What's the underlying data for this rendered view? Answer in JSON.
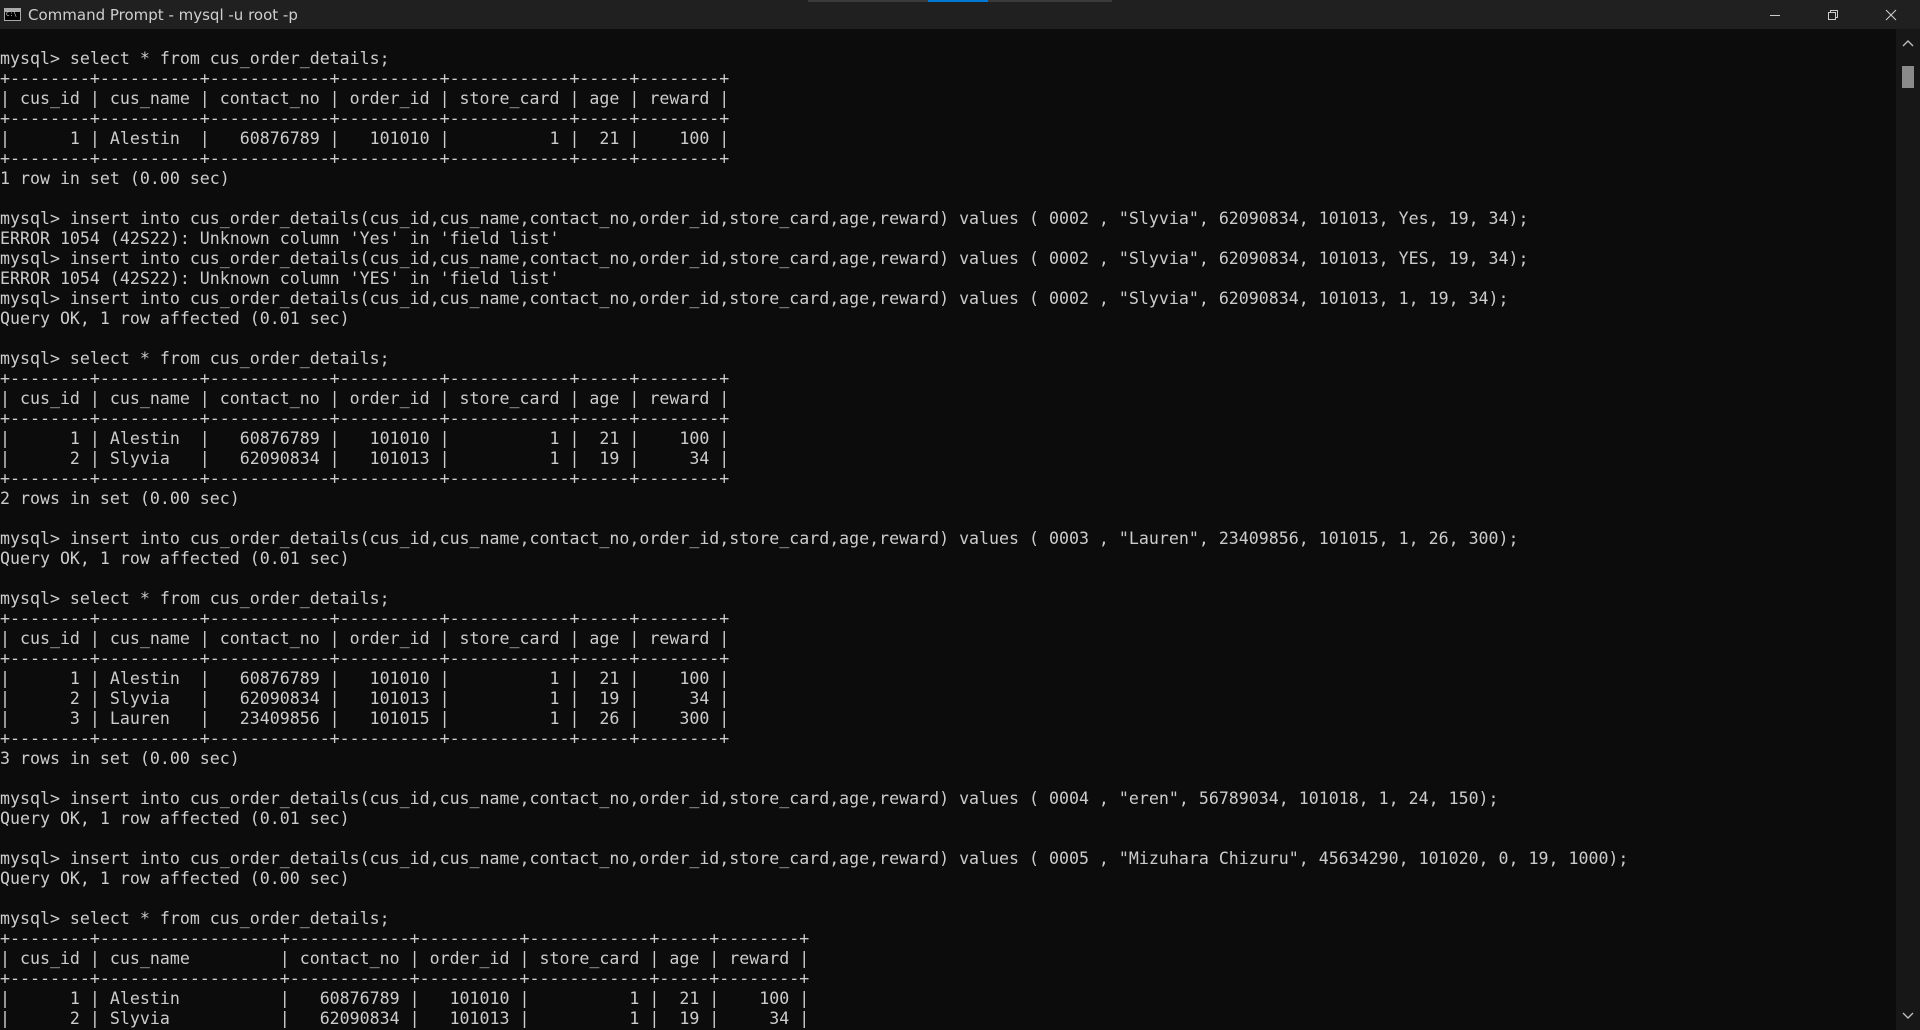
{
  "window": {
    "title": "Command Prompt - mysql  -u root -p"
  },
  "console": {
    "lines": [
      "mysql> select * from cus_order_details;",
      "+--------+----------+------------+----------+------------+-----+--------+",
      "| cus_id | cus_name | contact_no | order_id | store_card | age | reward |",
      "+--------+----------+------------+----------+------------+-----+--------+",
      "|      1 | Alestin  |   60876789 |   101010 |          1 |  21 |    100 |",
      "+--------+----------+------------+----------+------------+-----+--------+",
      "1 row in set (0.00 sec)",
      "",
      "mysql> insert into cus_order_details(cus_id,cus_name,contact_no,order_id,store_card,age,reward) values ( 0002 , \"Slyvia\", 62090834, 101013, Yes, 19, 34);",
      "ERROR 1054 (42S22): Unknown column 'Yes' in 'field list'",
      "mysql> insert into cus_order_details(cus_id,cus_name,contact_no,order_id,store_card,age,reward) values ( 0002 , \"Slyvia\", 62090834, 101013, YES, 19, 34);",
      "ERROR 1054 (42S22): Unknown column 'YES' in 'field list'",
      "mysql> insert into cus_order_details(cus_id,cus_name,contact_no,order_id,store_card,age,reward) values ( 0002 , \"Slyvia\", 62090834, 101013, 1, 19, 34);",
      "Query OK, 1 row affected (0.01 sec)",
      "",
      "mysql> select * from cus_order_details;",
      "+--------+----------+------------+----------+------------+-----+--------+",
      "| cus_id | cus_name | contact_no | order_id | store_card | age | reward |",
      "+--------+----------+------------+----------+------------+-----+--------+",
      "|      1 | Alestin  |   60876789 |   101010 |          1 |  21 |    100 |",
      "|      2 | Slyvia   |   62090834 |   101013 |          1 |  19 |     34 |",
      "+--------+----------+------------+----------+------------+-----+--------+",
      "2 rows in set (0.00 sec)",
      "",
      "mysql> insert into cus_order_details(cus_id,cus_name,contact_no,order_id,store_card,age,reward) values ( 0003 , \"Lauren\", 23409856, 101015, 1, 26, 300);",
      "Query OK, 1 row affected (0.01 sec)",
      "",
      "mysql> select * from cus_order_details;",
      "+--------+----------+------------+----------+------------+-----+--------+",
      "| cus_id | cus_name | contact_no | order_id | store_card | age | reward |",
      "+--------+----------+------------+----------+------------+-----+--------+",
      "|      1 | Alestin  |   60876789 |   101010 |          1 |  21 |    100 |",
      "|      2 | Slyvia   |   62090834 |   101013 |          1 |  19 |     34 |",
      "|      3 | Lauren   |   23409856 |   101015 |          1 |  26 |    300 |",
      "+--------+----------+------------+----------+------------+-----+--------+",
      "3 rows in set (0.00 sec)",
      "",
      "mysql> insert into cus_order_details(cus_id,cus_name,contact_no,order_id,store_card,age,reward) values ( 0004 , \"eren\", 56789034, 101018, 1, 24, 150);",
      "Query OK, 1 row affected (0.01 sec)",
      "",
      "mysql> insert into cus_order_details(cus_id,cus_name,contact_no,order_id,store_card,age,reward) values ( 0005 , \"Mizuhara Chizuru\", 45634290, 101020, 0, 19, 1000);",
      "Query OK, 1 row affected (0.00 sec)",
      "",
      "mysql> select * from cus_order_details;",
      "+--------+------------------+------------+----------+------------+-----+--------+",
      "| cus_id | cus_name         | contact_no | order_id | store_card | age | reward |",
      "+--------+------------------+------------+----------+------------+-----+--------+",
      "|      1 | Alestin          |   60876789 |   101010 |          1 |  21 |    100 |",
      "|      2 | Slyvia           |   62090834 |   101013 |          1 |  19 |     34 |"
    ]
  },
  "icons": {
    "app": "command-prompt-icon",
    "minimize": "minimize-icon",
    "maximize": "restore-icon",
    "close": "close-icon",
    "scroll_up": "scroll-up-arrow-icon",
    "scroll_down": "scroll-down-arrow-icon"
  },
  "colors": {
    "background": "#0c0c0c",
    "text": "#cccccc",
    "titlebar": "#202020",
    "accent": "#0078d4"
  },
  "scroll": {
    "position": 0.02
  }
}
